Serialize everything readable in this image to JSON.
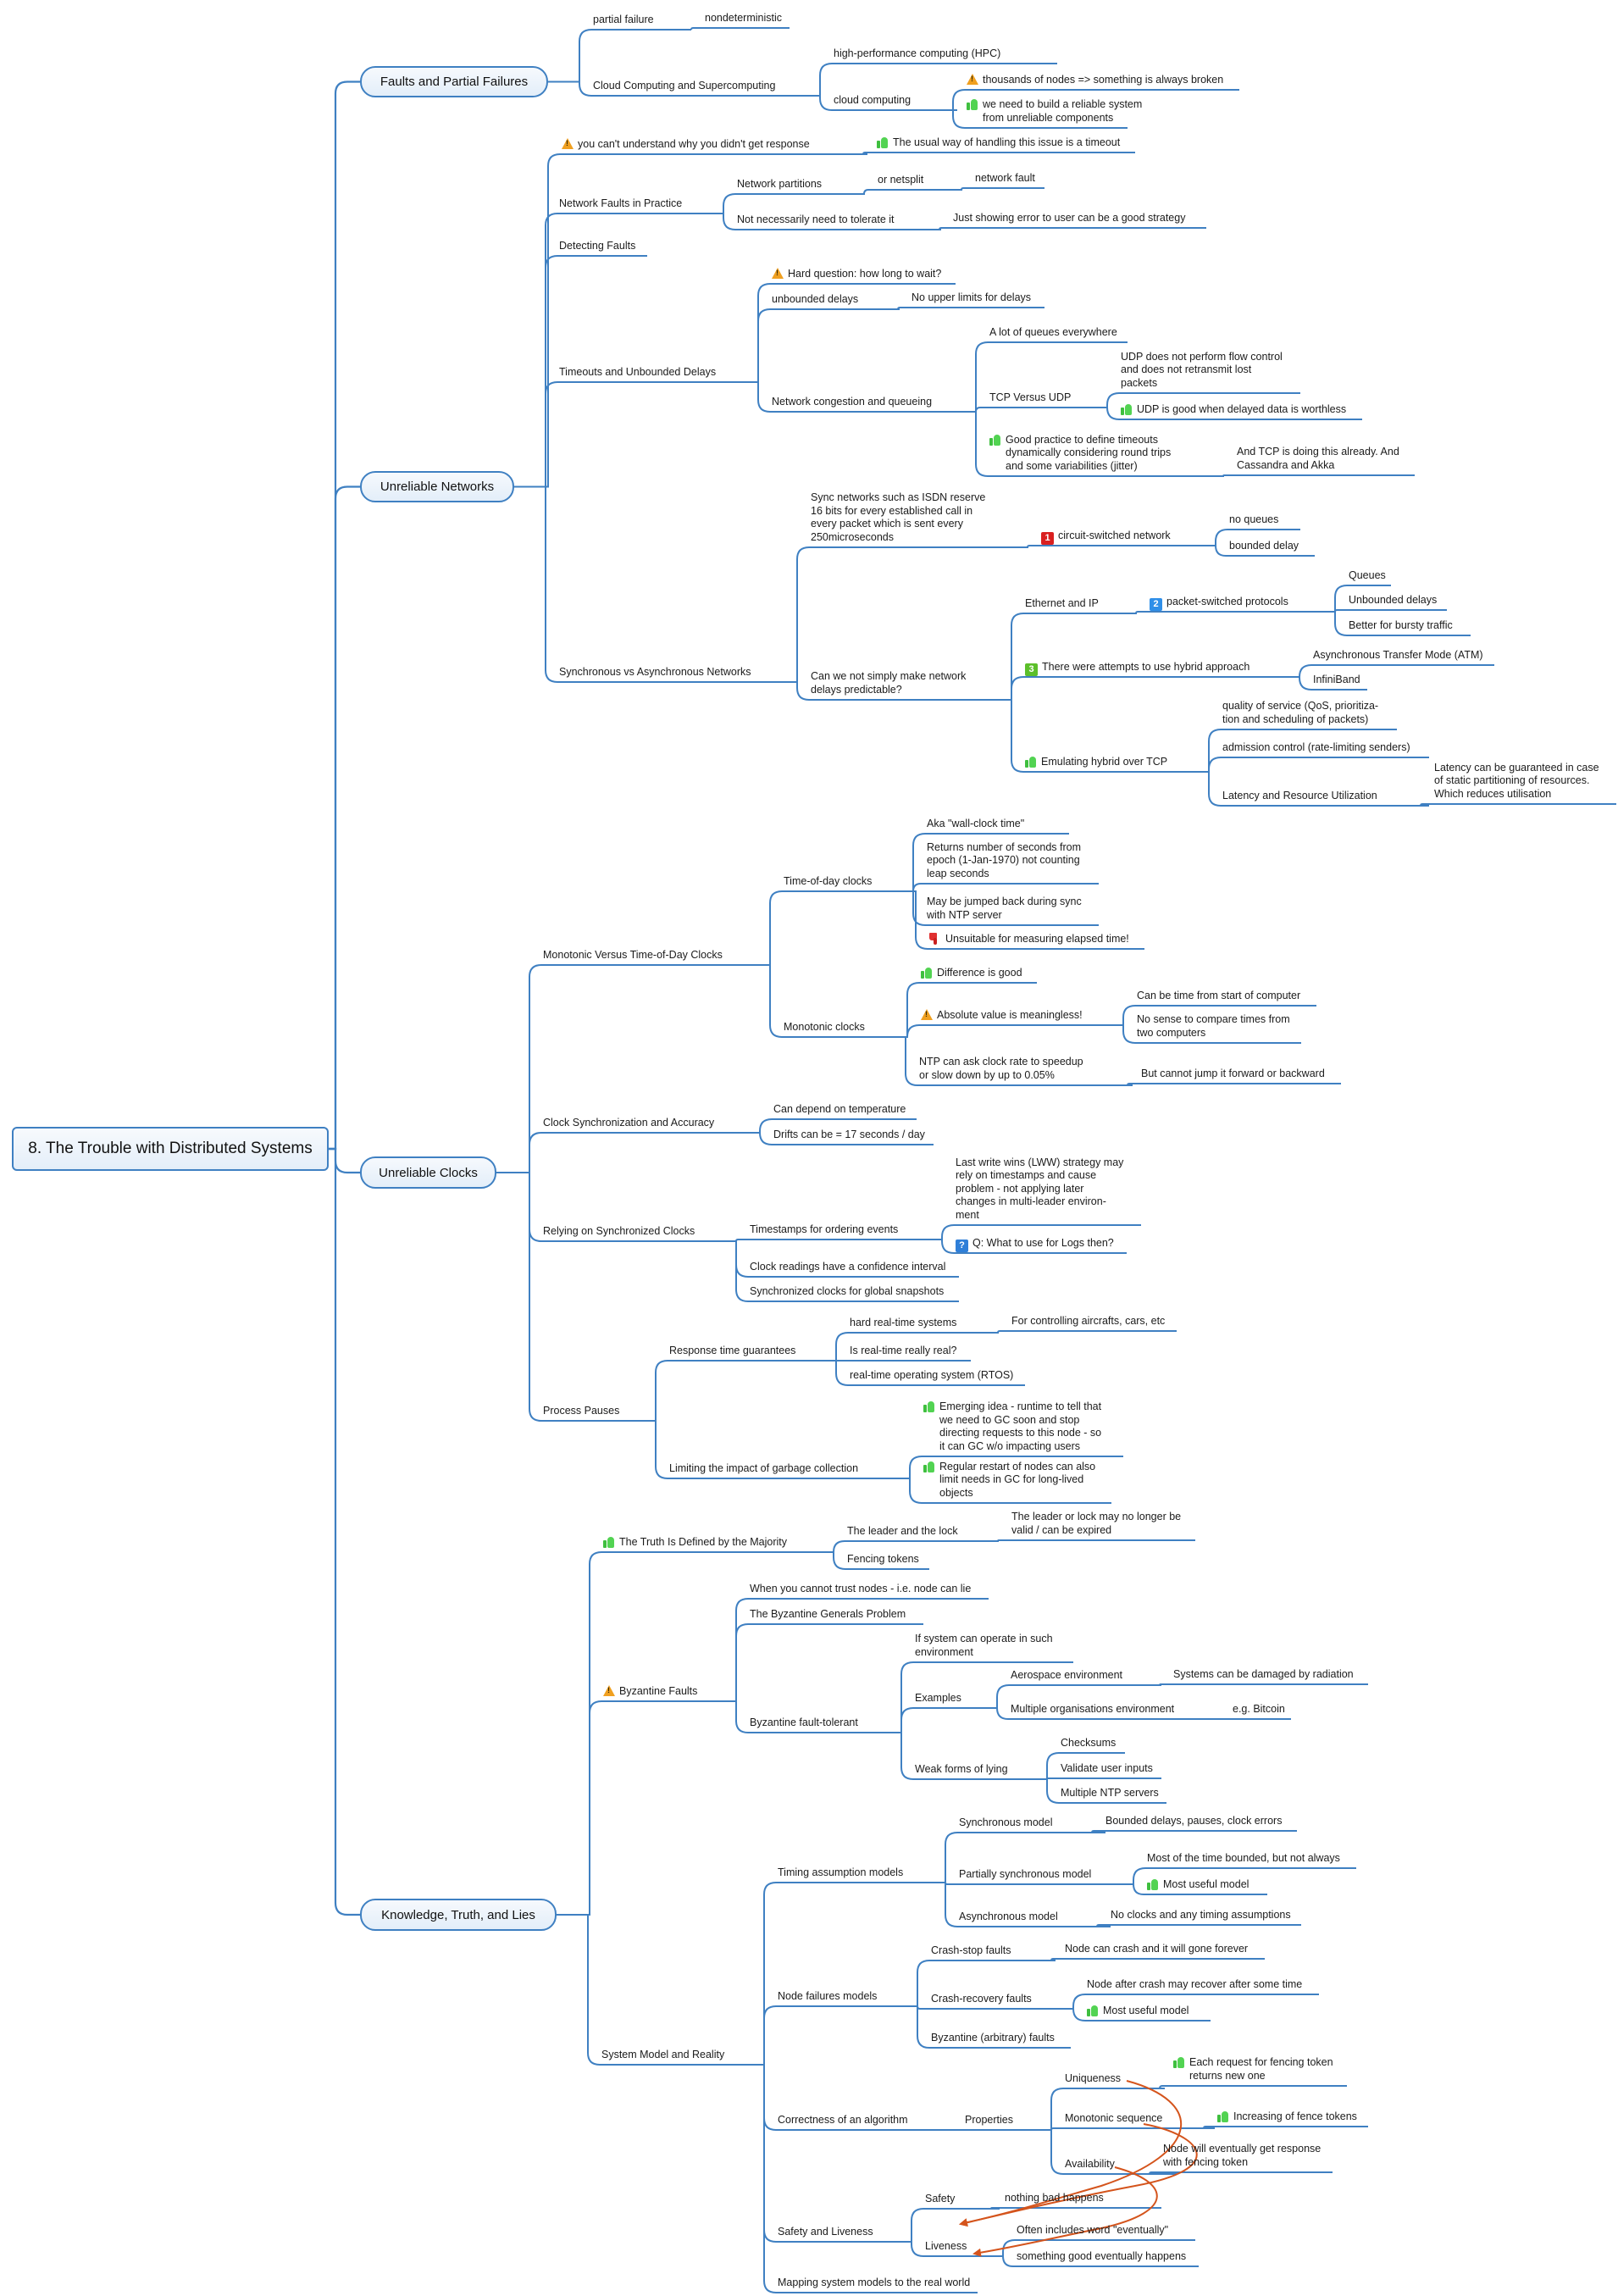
{
  "title": "8. The Trouble with Distributed Systems",
  "colors": {
    "line": "#3f80c2",
    "relationship": "#d4541c",
    "warning": "#f0a020",
    "thumbs_up": "#52d352",
    "thumbs_down": "#e03030",
    "badge_1": "#d92020",
    "badge_2": "#2f8fe8",
    "badge_3": "#5cbf2a",
    "badge_q": "#2f7fd8"
  },
  "topics": [
    {
      "id": "faults",
      "label": "Faults and Partial Failures"
    },
    {
      "id": "networks",
      "label": "Unreliable Networks"
    },
    {
      "id": "clocks",
      "label": "Unreliable Clocks"
    },
    {
      "id": "knowledge",
      "label": "Knowledge, Truth, and Lies"
    }
  ],
  "nodes": [
    {
      "id": "pf",
      "parent": "faults",
      "text": "partial failure"
    },
    {
      "id": "nondet",
      "parent": "pf",
      "text": "nondeterministic"
    },
    {
      "id": "ccs",
      "parent": "faults",
      "text": "Cloud Computing and Supercomputing"
    },
    {
      "id": "hpc",
      "parent": "ccs",
      "text": "high-performance computing (HPC)"
    },
    {
      "id": "cc",
      "parent": "ccs",
      "text": "cloud computing"
    },
    {
      "id": "thousands",
      "parent": "cc",
      "icon": "warning",
      "text": "thousands of nodes => something is always broken"
    },
    {
      "id": "weneed",
      "parent": "cc",
      "icon": "thumbs-up",
      "text": "we need to build a reliable system\nfrom unreliable components"
    },
    {
      "id": "cant",
      "parent": "networks",
      "icon": "warning",
      "text": "you can't understand why you didn't get response"
    },
    {
      "id": "usual",
      "parent": "cant",
      "icon": "thumbs-up",
      "text": "The usual way of handling this issue is a timeout"
    },
    {
      "id": "nfp",
      "parent": "networks",
      "text": "Network Faults in Practice"
    },
    {
      "id": "np",
      "parent": "nfp",
      "text": "Network partitions"
    },
    {
      "id": "netsplit",
      "parent": "np",
      "text": "or netsplit"
    },
    {
      "id": "netfault",
      "parent": "netsplit",
      "text": "network fault"
    },
    {
      "id": "notnec",
      "parent": "nfp",
      "text": "Not necessarily need to tolerate it"
    },
    {
      "id": "justshow",
      "parent": "notnec",
      "text": "Just showing error to user can be a good strategy"
    },
    {
      "id": "detect",
      "parent": "networks",
      "text": "Detecting Faults"
    },
    {
      "id": "tud",
      "parent": "networks",
      "text": "Timeouts and Unbounded Delays"
    },
    {
      "id": "hardq",
      "parent": "tud",
      "icon": "warning",
      "text": "Hard question: how long to wait?"
    },
    {
      "id": "unb",
      "parent": "tud",
      "text": "unbounded delays"
    },
    {
      "id": "noupper",
      "parent": "unb",
      "text": "No upper limits for delays"
    },
    {
      "id": "ncq",
      "parent": "tud",
      "text": "Network congestion and queueing"
    },
    {
      "id": "lotq",
      "parent": "ncq",
      "text": "A lot of queues everywhere"
    },
    {
      "id": "tcpudp",
      "parent": "ncq",
      "text": "TCP Versus UDP"
    },
    {
      "id": "udpno",
      "parent": "tcpudp",
      "text": "UDP does not perform flow control\nand does not retransmit lost\npackets"
    },
    {
      "id": "udpgood",
      "parent": "tcpudp",
      "icon": "thumbs-up",
      "text": "UDP is good when delayed data is worthless"
    },
    {
      "id": "goodpr",
      "parent": "ncq",
      "icon": "thumbs-up",
      "text": "Good practice to define timeouts\ndynamically considering round trips\nand some variabilities (jitter)"
    },
    {
      "id": "tcpdoing",
      "parent": "goodpr",
      "text": "And TCP is doing this already. And\nCassandra and Akka"
    },
    {
      "id": "sva",
      "parent": "networks",
      "text": "Synchronous vs Asynchronous Networks"
    },
    {
      "id": "isdn",
      "parent": "sva",
      "text": "Sync networks such as ISDN reserve\n16 bits for every established call in\nevery packet which is sent every\n250microseconds"
    },
    {
      "id": "circ",
      "parent": "isdn",
      "icon": "badge",
      "badge": "1",
      "badge_color": "#d92020",
      "text": "circuit-switched network"
    },
    {
      "id": "noq",
      "parent": "circ",
      "text": "no queues"
    },
    {
      "id": "bd",
      "parent": "circ",
      "text": "bounded delay"
    },
    {
      "id": "canwe",
      "parent": "sva",
      "text": "Can we not simply make network\ndelays predictable?"
    },
    {
      "id": "eth",
      "parent": "canwe",
      "text": "Ethernet and IP"
    },
    {
      "id": "pkt",
      "parent": "eth",
      "icon": "badge",
      "badge": "2",
      "badge_color": "#2f8fe8",
      "text": "packet-switched protocols"
    },
    {
      "id": "queues",
      "parent": "pkt",
      "text": "Queues"
    },
    {
      "id": "unbd",
      "parent": "pkt",
      "text": "Unbounded delays"
    },
    {
      "id": "bursty",
      "parent": "pkt",
      "text": "Better for bursty traffic"
    },
    {
      "id": "hybrid",
      "parent": "canwe",
      "icon": "badge",
      "badge": "3",
      "badge_color": "#5cbf2a",
      "text": "There were attempts to use hybrid approach"
    },
    {
      "id": "atm",
      "parent": "hybrid",
      "text": "Asynchronous Transfer Mode (ATM)"
    },
    {
      "id": "ib",
      "parent": "hybrid",
      "text": "InfiniBand"
    },
    {
      "id": "emul",
      "parent": "canwe",
      "icon": "thumbs-up",
      "text": "Emulating hybrid over TCP"
    },
    {
      "id": "qos",
      "parent": "emul",
      "text": "quality of service (QoS, prioritiza-\ntion and scheduling of packets)"
    },
    {
      "id": "adm",
      "parent": "emul",
      "text": "admission control (rate-limiting senders)"
    },
    {
      "id": "lru",
      "parent": "emul",
      "text": "Latency and Resource Utilization"
    },
    {
      "id": "latg",
      "parent": "lru",
      "text": "Latency can be guaranteed in case\nof static partitioning of resources.\nWhich reduces utilisation"
    },
    {
      "id": "mvt",
      "parent": "clocks",
      "text": "Monotonic Versus Time-of-Day Clocks"
    },
    {
      "id": "tod",
      "parent": "mvt",
      "text": "Time-of-day clocks"
    },
    {
      "id": "aka",
      "parent": "tod",
      "text": "Aka \"wall-clock time\""
    },
    {
      "id": "returns",
      "parent": "tod",
      "text": "Returns number of seconds from\nepoch (1-Jan-1970) not counting\nleap seconds"
    },
    {
      "id": "jumped",
      "parent": "tod",
      "text": "May be jumped back during sync\nwith NTP server"
    },
    {
      "id": "unsuit",
      "parent": "tod",
      "icon": "thumbs-down",
      "text": "Unsuitable for measuring elapsed time!"
    },
    {
      "id": "mono",
      "parent": "mvt",
      "text": "Monotonic clocks"
    },
    {
      "id": "diff",
      "parent": "mono",
      "icon": "thumbs-up",
      "text": "Difference is good"
    },
    {
      "id": "absv",
      "parent": "mono",
      "icon": "warning",
      "text": "Absolute value is meaningless!"
    },
    {
      "id": "start",
      "parent": "absv",
      "text": "Can be time from start of computer"
    },
    {
      "id": "nosense",
      "parent": "absv",
      "text": "No sense to compare times from\ntwo computers"
    },
    {
      "id": "ntpask",
      "parent": "mono",
      "text": "NTP can ask clock rate to speedup\nor slow down by up to 0.05%"
    },
    {
      "id": "cannotjump",
      "parent": "ntpask",
      "text": "But cannot jump it forward or backward"
    },
    {
      "id": "csa",
      "parent": "clocks",
      "text": "Clock Synchronization and Accuracy"
    },
    {
      "id": "temp",
      "parent": "csa",
      "text": "Can depend on temperature"
    },
    {
      "id": "drift",
      "parent": "csa",
      "text": "Drifts can be = 17 seconds / day"
    },
    {
      "id": "rsc",
      "parent": "clocks",
      "text": "Relying on Synchronized Clocks"
    },
    {
      "id": "tsorder",
      "parent": "rsc",
      "text": "Timestamps for ordering events"
    },
    {
      "id": "lww",
      "parent": "tsorder",
      "text": "Last write wins (LWW) strategy may\nrely on timestamps and cause\nproblem - not applying later\nchanges in multi-leader environ-\nment"
    },
    {
      "id": "qlogs",
      "parent": "tsorder",
      "icon": "badge",
      "badge": "?",
      "badge_color": "#2f7fd8",
      "text": "Q: What to use for Logs then?"
    },
    {
      "id": "confint",
      "parent": "rsc",
      "text": "Clock readings have a confidence interval"
    },
    {
      "id": "snap",
      "parent": "rsc",
      "text": "Synchronized clocks for global snapshots"
    },
    {
      "id": "pp",
      "parent": "clocks",
      "text": "Process Pauses"
    },
    {
      "id": "rtg",
      "parent": "pp",
      "text": "Response time guarantees"
    },
    {
      "id": "hrt",
      "parent": "rtg",
      "text": "hard real-time systems"
    },
    {
      "id": "ctrl",
      "parent": "hrt",
      "text": "For controlling aircrafts, cars, etc"
    },
    {
      "id": "isrt",
      "parent": "rtg",
      "text": "Is real-time really real?"
    },
    {
      "id": "rtos",
      "parent": "rtg",
      "text": "real-time operating system (RTOS)"
    },
    {
      "id": "gc",
      "parent": "pp",
      "text": "Limiting the impact of garbage collection"
    },
    {
      "id": "emerg",
      "parent": "gc",
      "icon": "thumbs-up",
      "text": "Emerging idea - runtime to tell that\nwe need to GC soon and stop\ndirecting requests to this node - so\nit can GC w/o impacting users"
    },
    {
      "id": "restart",
      "parent": "gc",
      "icon": "thumbs-up",
      "text": "Regular restart of nodes can also\nlimit needs in GC for long-lived\nobjects"
    },
    {
      "id": "truth",
      "parent": "knowledge",
      "icon": "thumbs-up",
      "text": "The Truth Is Defined by the Majority"
    },
    {
      "id": "leaderlock",
      "parent": "truth",
      "text": "The leader and the lock"
    },
    {
      "id": "expired",
      "parent": "leaderlock",
      "text": "The leader or lock may no longer be\nvalid / can be expired"
    },
    {
      "id": "fencing",
      "parent": "truth",
      "text": "Fencing tokens"
    },
    {
      "id": "byz",
      "parent": "knowledge",
      "icon": "warning",
      "text": "Byzantine Faults"
    },
    {
      "id": "notrust",
      "parent": "byz",
      "text": "When you cannot trust nodes - i.e. node can lie"
    },
    {
      "id": "generals",
      "parent": "byz",
      "text": "The Byzantine Generals Problem"
    },
    {
      "id": "bft",
      "parent": "byz",
      "text": "Byzantine fault-tolerant"
    },
    {
      "id": "ifsys",
      "parent": "bft",
      "text": "If system can operate in such\nenvironment"
    },
    {
      "id": "examples",
      "parent": "bft",
      "text": "Examples"
    },
    {
      "id": "aero",
      "parent": "examples",
      "text": "Aerospace environment"
    },
    {
      "id": "radiation",
      "parent": "aero",
      "text": "Systems can be damaged by radiation"
    },
    {
      "id": "multorg",
      "parent": "examples",
      "text": "Multiple organisations environment"
    },
    {
      "id": "bitcoin",
      "parent": "multorg",
      "text": "e.g. Bitcoin"
    },
    {
      "id": "weak",
      "parent": "bft",
      "text": "Weak forms of lying"
    },
    {
      "id": "checksums",
      "parent": "weak",
      "text": "Checksums"
    },
    {
      "id": "validate",
      "parent": "weak",
      "text": "Validate user inputs"
    },
    {
      "id": "ntpservers",
      "parent": "weak",
      "text": "Multiple NTP servers"
    },
    {
      "id": "smr",
      "parent": "knowledge",
      "text": "System Model and Reality"
    },
    {
      "id": "tam",
      "parent": "smr",
      "text": "Timing assumption models"
    },
    {
      "id": "syncm",
      "parent": "tam",
      "text": "Synchronous model"
    },
    {
      "id": "bdpc",
      "parent": "syncm",
      "text": "Bounded delays, pauses, clock errors"
    },
    {
      "id": "psync",
      "parent": "tam",
      "text": "Partially synchronous model"
    },
    {
      "id": "mostb",
      "parent": "psync",
      "text": "Most of the time bounded, but not always"
    },
    {
      "id": "useful1",
      "parent": "psync",
      "icon": "thumbs-up",
      "text": "Most useful model"
    },
    {
      "id": "asyncm",
      "parent": "tam",
      "text": "Asynchronous model"
    },
    {
      "id": "noclocks",
      "parent": "asyncm",
      "text": "No clocks and any timing assumptions"
    },
    {
      "id": "nfm",
      "parent": "smr",
      "text": "Node failures models"
    },
    {
      "id": "crashstop",
      "parent": "nfm",
      "text": "Crash-stop faults"
    },
    {
      "id": "gone",
      "parent": "crashstop",
      "text": "Node can crash and it will gone forever"
    },
    {
      "id": "crashrec",
      "parent": "nfm",
      "text": "Crash-recovery faults"
    },
    {
      "id": "recover",
      "parent": "crashrec",
      "text": "Node after crash may recover after some time"
    },
    {
      "id": "useful2",
      "parent": "crashrec",
      "icon": "thumbs-up",
      "text": "Most useful model"
    },
    {
      "id": "byzarb",
      "parent": "nfm",
      "text": "Byzantine (arbitrary) faults"
    },
    {
      "id": "correct",
      "parent": "smr",
      "text": "Correctness of an algorithm"
    },
    {
      "id": "props",
      "parent": "correct",
      "text": "Properties"
    },
    {
      "id": "uniq",
      "parent": "props",
      "text": "Uniqueness"
    },
    {
      "id": "eachreq",
      "parent": "uniq",
      "icon": "thumbs-up",
      "text": "Each request for fencing token\nreturns new one"
    },
    {
      "id": "monoseq",
      "parent": "props",
      "text": "Monotonic sequence"
    },
    {
      "id": "incfence",
      "parent": "monoseq",
      "icon": "thumbs-up",
      "text": "Increasing of fence tokens"
    },
    {
      "id": "avail",
      "parent": "props",
      "text": "Availability"
    },
    {
      "id": "eventually",
      "parent": "avail",
      "text": "Node will eventually get response\nwith fencing token"
    },
    {
      "id": "sl",
      "parent": "smr",
      "text": "Safety and Liveness"
    },
    {
      "id": "safety",
      "parent": "sl",
      "text": "Safety"
    },
    {
      "id": "nothingbad",
      "parent": "safety",
      "text": "nothing bad happens"
    },
    {
      "id": "liveness",
      "parent": "sl",
      "text": "Liveness"
    },
    {
      "id": "oftenev",
      "parent": "liveness",
      "text": "Often includes word \"eventually\""
    },
    {
      "id": "somethinggood",
      "parent": "liveness",
      "text": "something good eventually happens"
    },
    {
      "id": "mapping",
      "parent": "smr",
      "text": "Mapping system models to the real world"
    }
  ],
  "relationships": [
    {
      "from": "uniq",
      "to": "safety"
    },
    {
      "from": "monoseq",
      "to": "safety"
    },
    {
      "from": "avail",
      "to": "liveness"
    }
  ]
}
